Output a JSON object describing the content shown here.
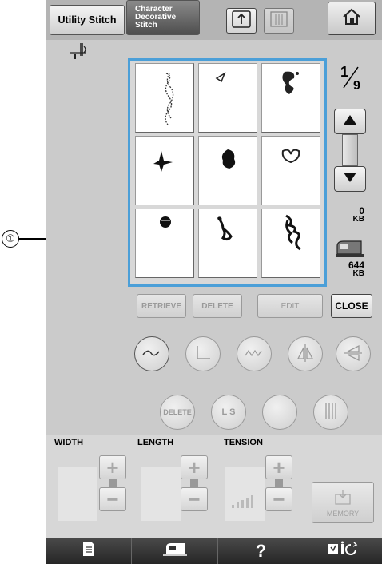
{
  "tabs": {
    "utility": "Utility Stitch",
    "character_decorative": [
      "Character",
      "Decorative",
      "Stitch"
    ]
  },
  "pattern_grid": {
    "page": "1/9",
    "cells": [
      {
        "icon": "stitch-pattern-1"
      },
      {
        "icon": "stitch-pattern-2"
      },
      {
        "icon": "stitch-pattern-3"
      },
      {
        "icon": "stitch-pattern-4"
      },
      {
        "icon": "stitch-pattern-5"
      },
      {
        "icon": "stitch-pattern-6"
      },
      {
        "icon": "stitch-pattern-7"
      },
      {
        "icon": "stitch-pattern-8"
      },
      {
        "icon": "stitch-pattern-9"
      }
    ]
  },
  "memory": {
    "used_value": "0",
    "used_unit": "KB",
    "free_value": "644",
    "free_unit": "KB"
  },
  "actions": {
    "retrieve": "RETRIEVE",
    "delete": "DELETE",
    "edit": "EDIT",
    "close": "CLOSE"
  },
  "edit_row2": {
    "delete": "DELETE",
    "ls": "L S"
  },
  "settings": {
    "width_label": "WIDTH",
    "length_label": "LENGTH",
    "tension_label": "TENSION",
    "plus": "+",
    "minus": "−",
    "memory_label": "MEMORY"
  },
  "footer": {
    "help": "?"
  },
  "callout": {
    "number": "①"
  },
  "colors": {
    "selection_border": "#4b9fd8",
    "panel": "#cbcbcb",
    "footer": "#1e1e1e"
  }
}
